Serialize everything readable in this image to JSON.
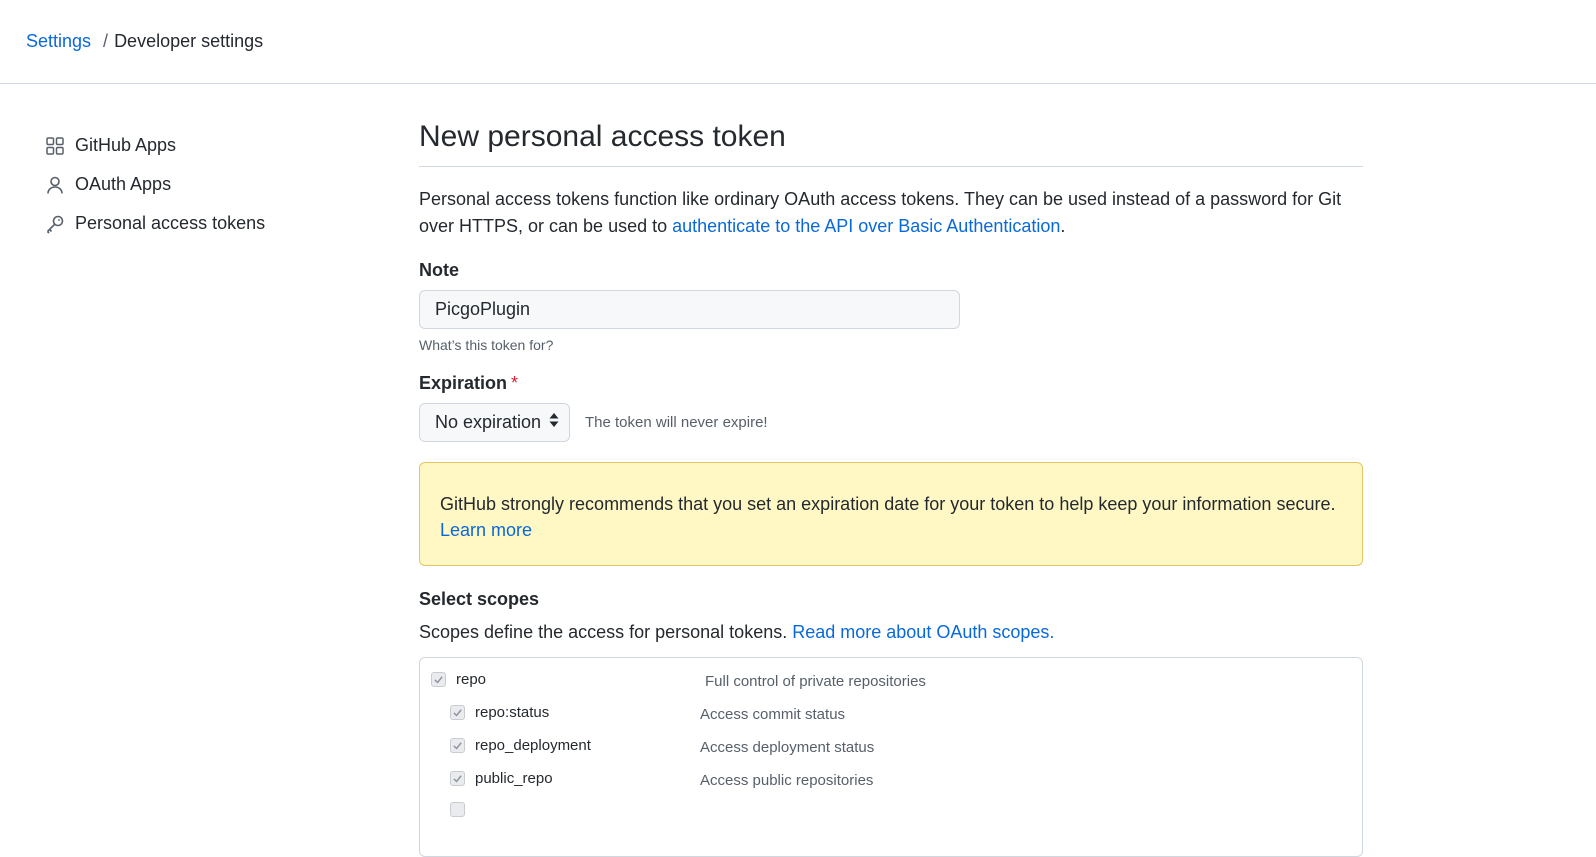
{
  "breadcrumb": {
    "root": "Settings",
    "separator": "/",
    "current": "Developer settings"
  },
  "sidebar": {
    "items": [
      {
        "label": "GitHub Apps",
        "icon": "apps-icon"
      },
      {
        "label": "OAuth Apps",
        "icon": "person-icon"
      },
      {
        "label": "Personal access tokens",
        "icon": "key-icon"
      }
    ]
  },
  "main": {
    "title": "New personal access token",
    "description_part1": "Personal access tokens function like ordinary OAuth access tokens. They can be used instead of a password for Git over HTTPS, or can be used to ",
    "description_link": "authenticate to the API over Basic Authentication",
    "description_end": ".",
    "note_label": "Note",
    "note_value": "PicgoPlugin",
    "note_hint": "What’s this token for?",
    "expiration_label": "Expiration",
    "expiration_required_mark": "*",
    "expiration_value": "No expiration",
    "expiration_note": "The token will never expire!",
    "warning_text": "GitHub strongly recommends that you set an expiration date for your token to help keep your information secure.",
    "warning_link": "Learn more",
    "scopes_title": "Select scopes",
    "scopes_desc": "Scopes define the access for personal tokens.",
    "scopes_link": "Read more about OAuth scopes.",
    "scopes": [
      {
        "name": "repo",
        "description": "Full control of private repositories",
        "checked": true
      },
      {
        "name": "repo:status",
        "description": "Access commit status",
        "checked": true
      },
      {
        "name": "repo_deployment",
        "description": "Access deployment status",
        "checked": true
      },
      {
        "name": "public_repo",
        "description": "Access public repositories",
        "checked": true
      }
    ]
  },
  "colors": {
    "link": "#0969da",
    "warning_bg": "#fff8c5",
    "warning_border": "#e3c565",
    "required": "#cf222e"
  }
}
